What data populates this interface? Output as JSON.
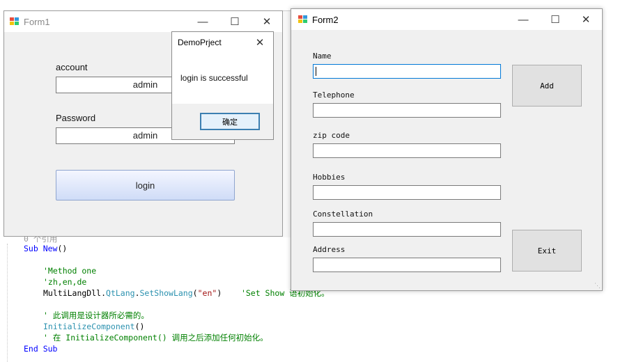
{
  "code_editor": {
    "lines": [
      {
        "parts": [
          {
            "t": "0 个引用",
            "c": "gray"
          }
        ]
      },
      {
        "parts": [
          {
            "t": "Sub ",
            "c": "kw"
          },
          {
            "t": "New",
            "c": "kw"
          },
          {
            "t": "()",
            "c": ""
          }
        ]
      },
      {
        "parts": [
          {
            "t": "'Method one",
            "c": "cm"
          }
        ]
      },
      {
        "parts": [
          {
            "t": "'zh,en,de",
            "c": "cm"
          }
        ]
      },
      {
        "parts": [
          {
            "t": "MultiLangDll.",
            "c": ""
          },
          {
            "t": "QtLang",
            "c": "tp"
          },
          {
            "t": ".",
            "c": ""
          },
          {
            "t": "SetShowLang",
            "c": "tp"
          },
          {
            "t": "(",
            "c": ""
          },
          {
            "t": "\"en\"",
            "c": "st"
          },
          {
            "t": ")    ",
            "c": ""
          },
          {
            "t": "'Set Show 语初始化。",
            "c": "cm"
          }
        ]
      },
      {
        "parts": [
          {
            "t": "' 此调用是设计器所必需的。",
            "c": "cm"
          }
        ]
      },
      {
        "parts": [
          {
            "t": "InitializeComponent",
            "c": "tp"
          },
          {
            "t": "()",
            "c": ""
          }
        ]
      },
      {
        "parts": [
          {
            "t": "' 在 InitializeComponent() 调用之后添加任何初始化。",
            "c": "cm"
          }
        ]
      },
      {
        "parts": [
          {
            "t": "End Sub",
            "c": "kw"
          }
        ]
      }
    ]
  },
  "form1": {
    "title": "Form1",
    "account_label": "account",
    "account_value": "admin",
    "password_label": "Password",
    "password_value": "admin",
    "login_label": "login"
  },
  "dialog": {
    "title": "DemoPrject",
    "message": "login is successful",
    "ok_label": "确定"
  },
  "form2": {
    "title": "Form2",
    "fields": [
      {
        "label": "Name",
        "value": ""
      },
      {
        "label": "Telephone",
        "value": ""
      },
      {
        "label": "zip code",
        "value": ""
      },
      {
        "label": "Hobbies",
        "value": ""
      },
      {
        "label": "Constellation",
        "value": ""
      },
      {
        "label": "Address",
        "value": ""
      }
    ],
    "add_label": "Add",
    "exit_label": "Exit"
  },
  "colors": {
    "login_button_gradient_top": "#f4f6ff",
    "login_button_gradient_bottom": "#cfdcf7",
    "focus_border": "#0078d7"
  }
}
